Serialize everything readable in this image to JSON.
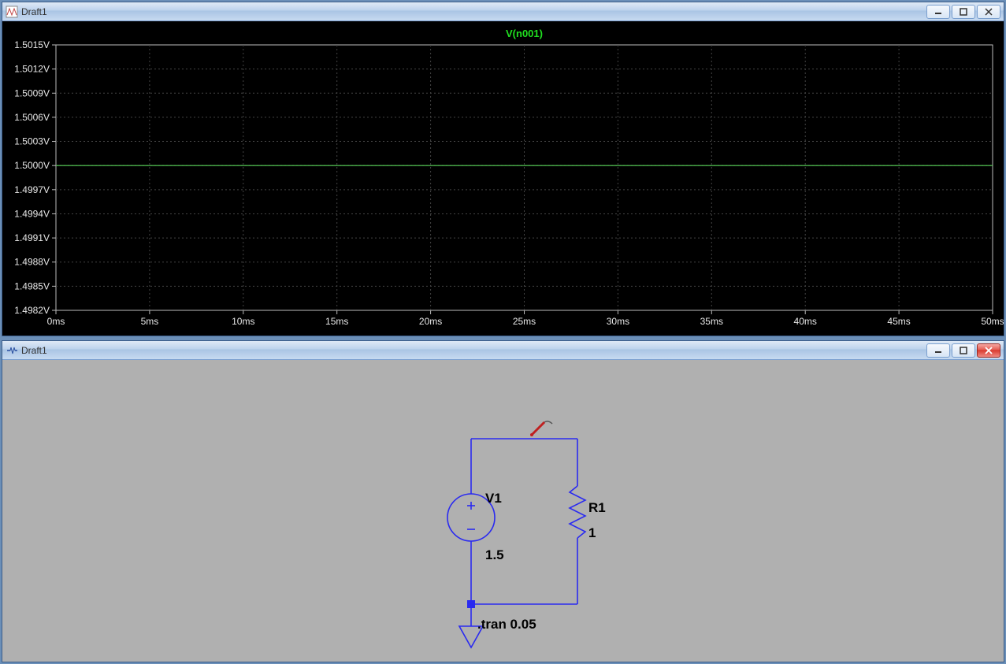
{
  "wave_window": {
    "title": "Draft1",
    "trace_label": "V(n001)"
  },
  "schem_window": {
    "title": "Draft1"
  },
  "schematic": {
    "v_name": "V1",
    "v_value": "1.5",
    "r_name": "R1",
    "r_value": "1",
    "directive": ".tran 0.05"
  },
  "chart_data": {
    "type": "line",
    "title": "V(n001)",
    "xlabel": "",
    "ylabel": "",
    "xlim": [
      0,
      50
    ],
    "ylim": [
      1.4982,
      1.5015
    ],
    "x_ticks_ms": [
      0,
      5,
      10,
      15,
      20,
      25,
      30,
      35,
      40,
      45,
      50
    ],
    "x_tick_labels": [
      "0ms",
      "5ms",
      "10ms",
      "15ms",
      "20ms",
      "25ms",
      "30ms",
      "35ms",
      "40ms",
      "45ms",
      "50ms"
    ],
    "y_ticks_v": [
      1.4982,
      1.4985,
      1.4988,
      1.4991,
      1.4994,
      1.4997,
      1.5,
      1.5003,
      1.5006,
      1.5009,
      1.5012,
      1.5015
    ],
    "y_tick_labels": [
      "1.4982V",
      "1.4985V",
      "1.4988V",
      "1.4991V",
      "1.4994V",
      "1.4997V",
      "1.5000V",
      "1.5003V",
      "1.5006V",
      "1.5009V",
      "1.5012V",
      "1.5015V"
    ],
    "series": [
      {
        "name": "V(n001)",
        "x_ms": [
          0,
          50
        ],
        "y_v": [
          1.5,
          1.5
        ],
        "color": "#5bd75b"
      }
    ]
  }
}
